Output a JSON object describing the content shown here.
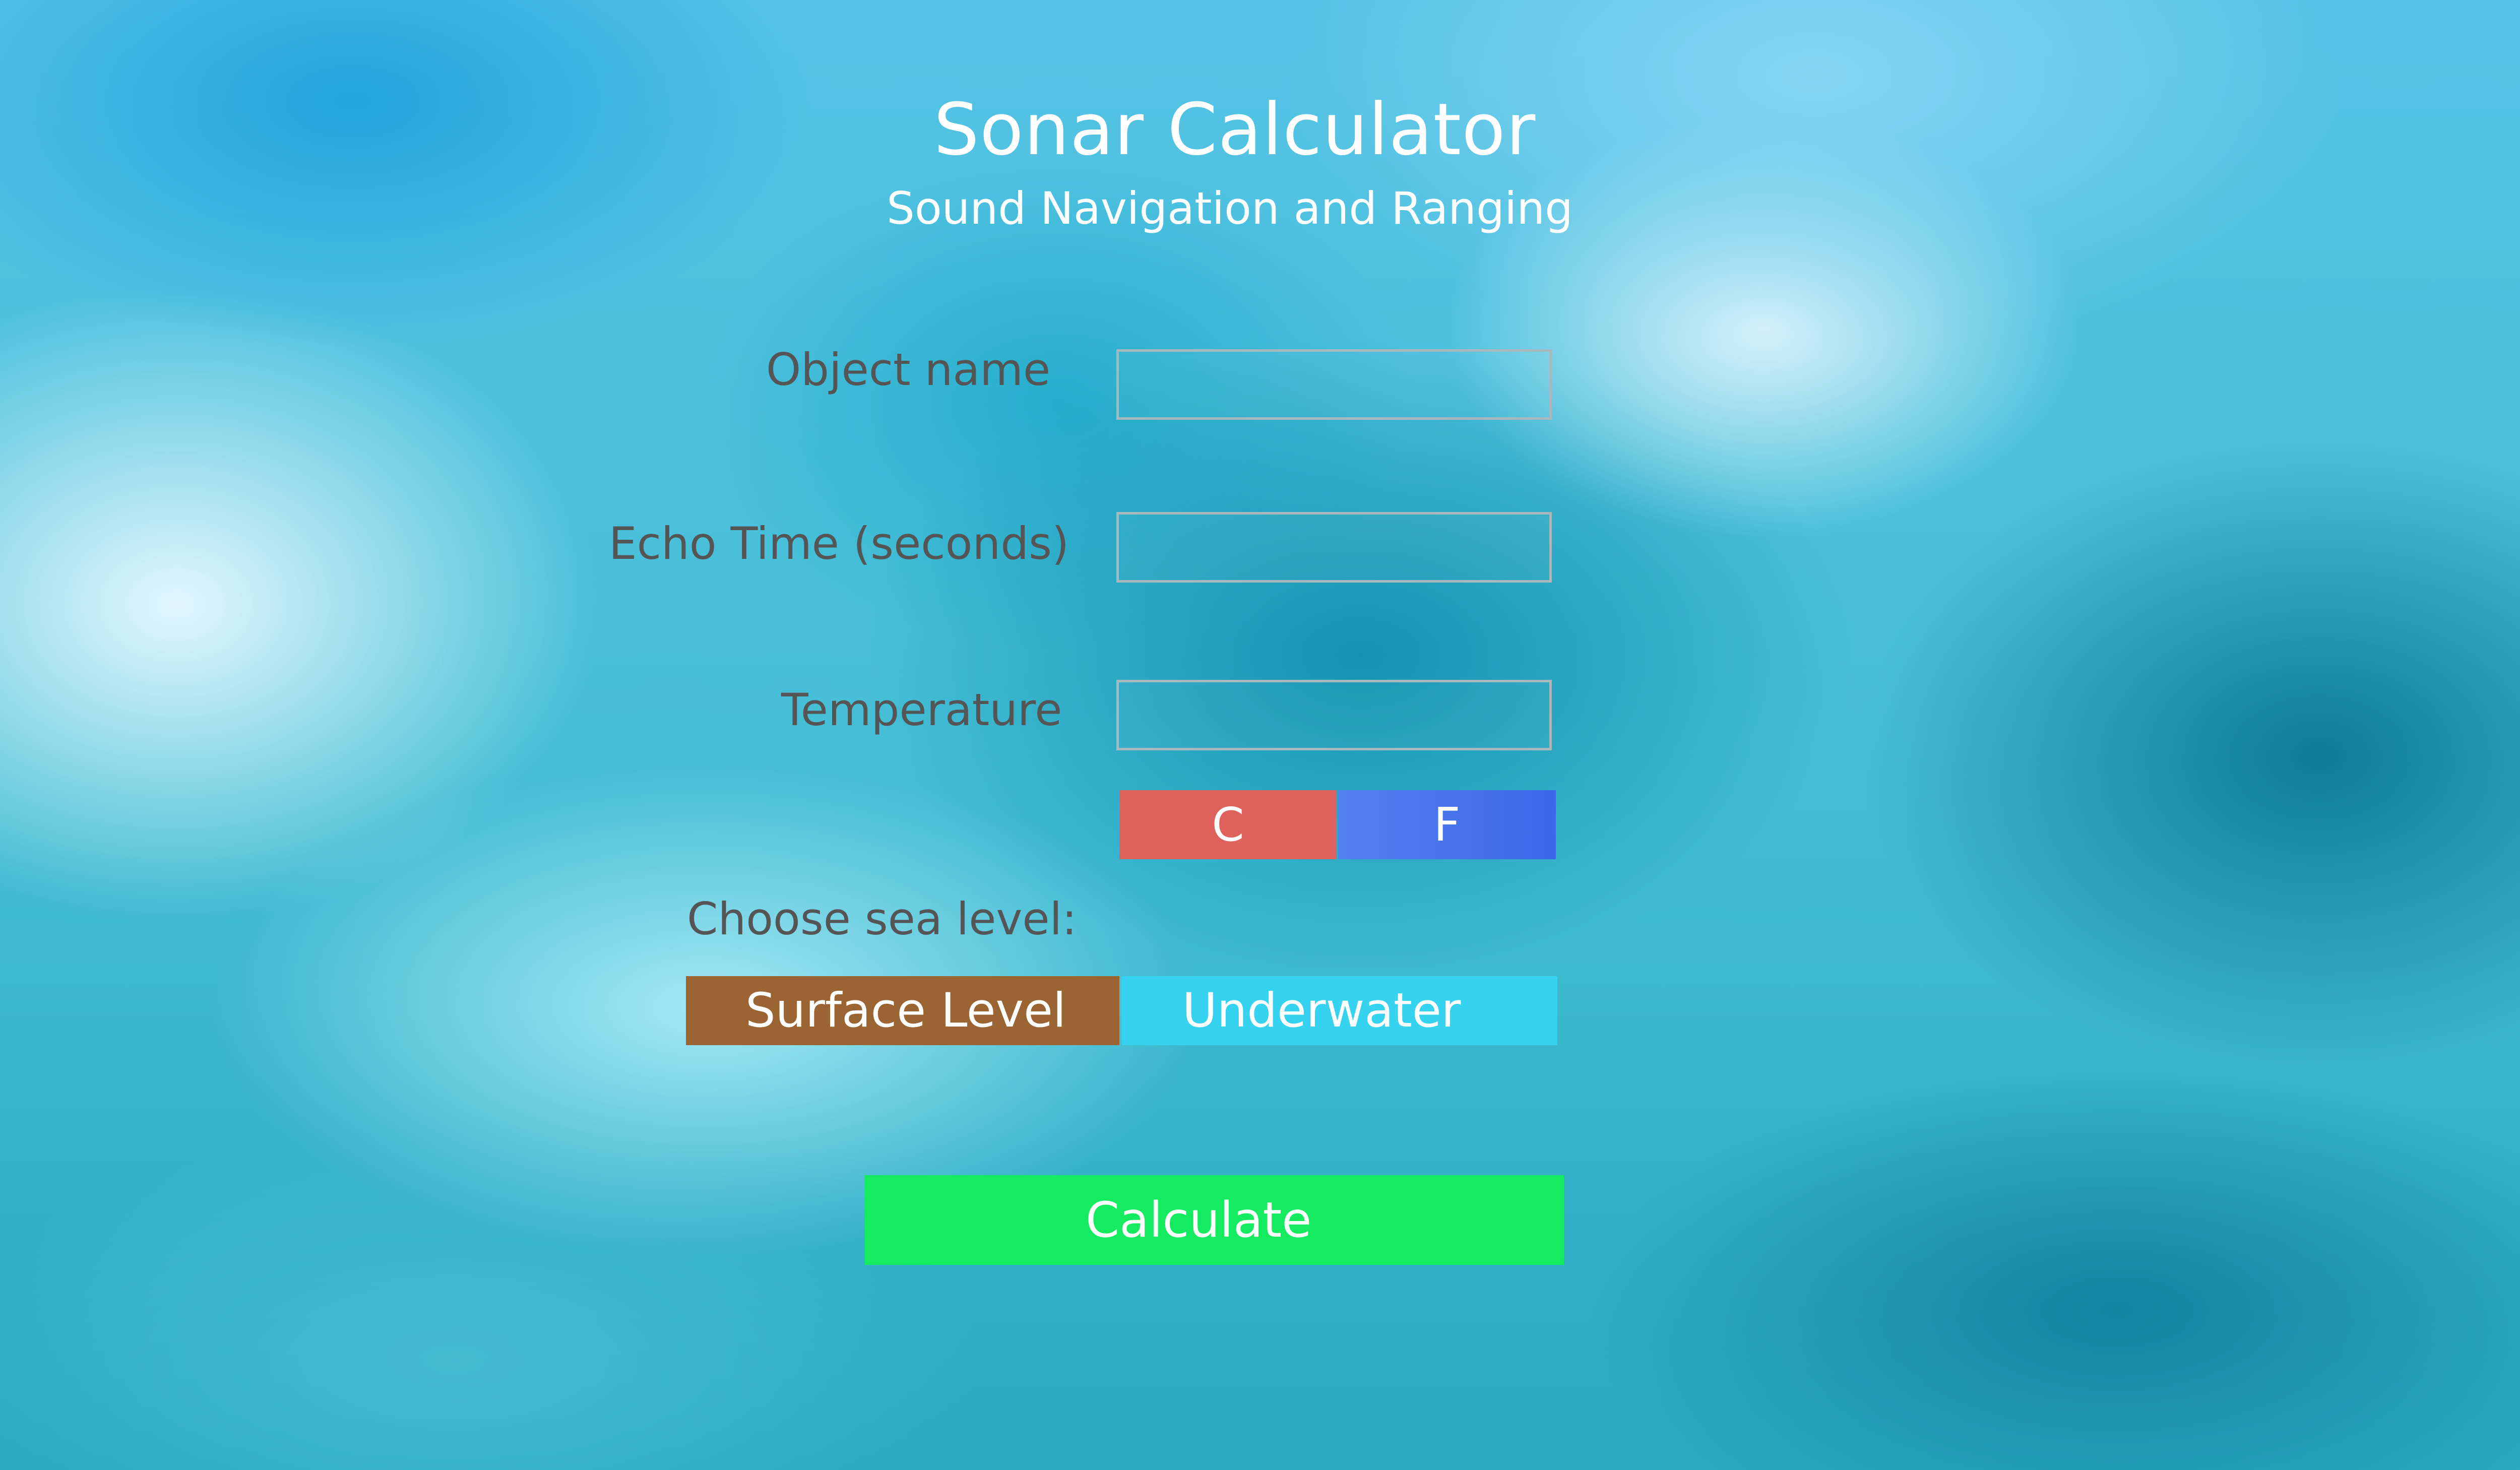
{
  "header": {
    "title": "Sonar Calculator",
    "subtitle": "Sound Navigation and Ranging"
  },
  "form": {
    "object_name": {
      "label": "Object name",
      "value": "",
      "placeholder": ""
    },
    "echo_time": {
      "label": "Echo Time (seconds)",
      "value": "",
      "placeholder": ""
    },
    "temperature": {
      "label": "Temperature",
      "value": "",
      "placeholder": ""
    },
    "temperature_units": {
      "celsius_label": "C",
      "fahrenheit_label": "F"
    },
    "sea_level": {
      "label": "Choose sea level:",
      "surface_label": "Surface Level",
      "underwater_label": "Underwater"
    },
    "calculate_label": "Calculate"
  },
  "colors": {
    "celsius_button": "#e0625d",
    "fahrenheit_button": "#3b68e8",
    "surface_button": "#9a6533",
    "underwater_button": "#35d3ef",
    "calculate_button": "#14eb5e",
    "label_text": "#555555",
    "title_text": "#ffffff"
  }
}
